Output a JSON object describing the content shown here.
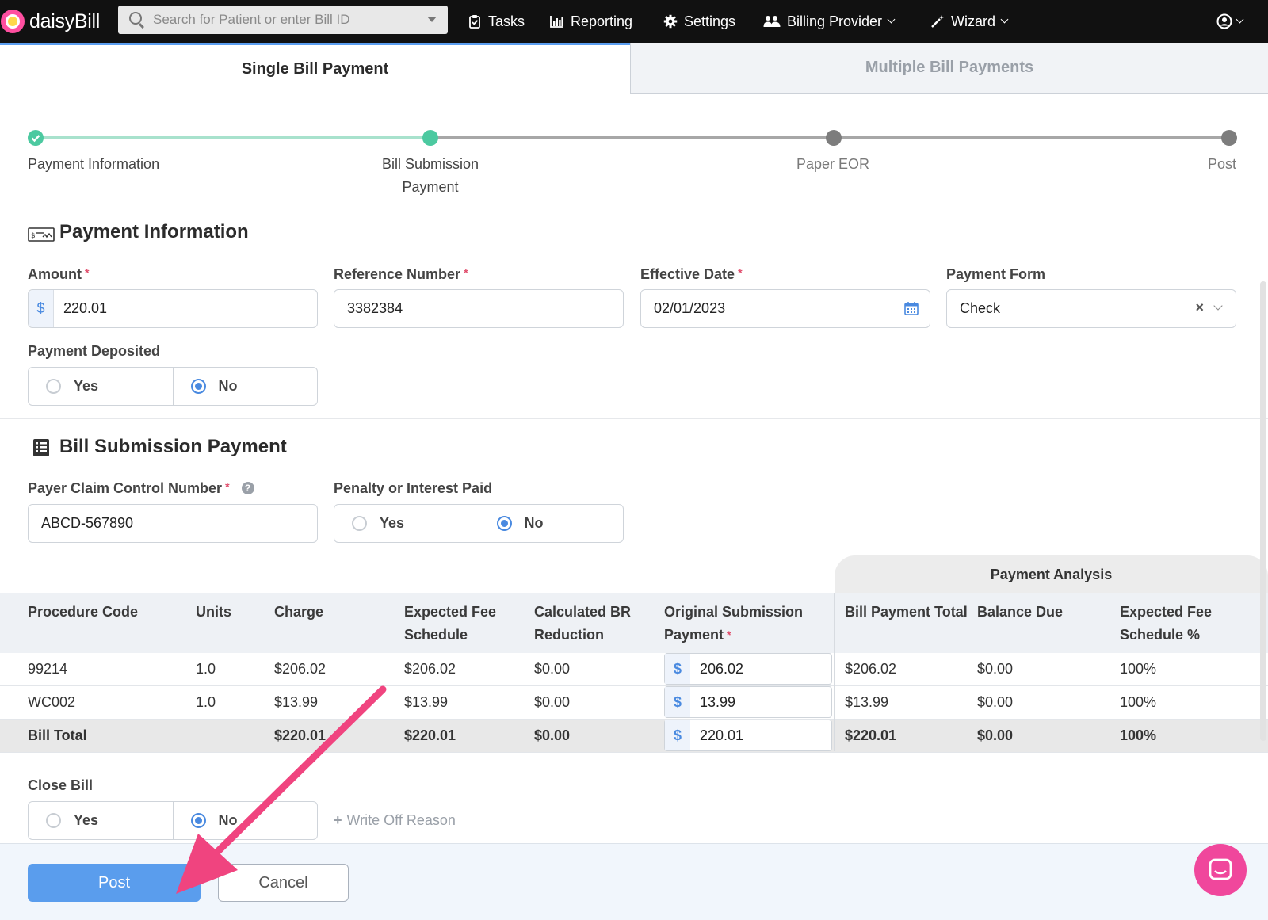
{
  "nav": {
    "logo_text": "daisyBill",
    "search_placeholder": "Search for Patient or enter Bill ID",
    "items": [
      {
        "label": "Tasks",
        "icon": "clipboard-check-icon"
      },
      {
        "label": "Reporting",
        "icon": "bar-chart-icon"
      },
      {
        "label": "Settings",
        "icon": "gear-icon"
      },
      {
        "label": "Billing Provider",
        "icon": "users-icon"
      },
      {
        "label": "Wizard",
        "icon": "magic-wand-icon"
      }
    ]
  },
  "tabs": {
    "single": "Single Bill Payment",
    "multiple": "Multiple Bill Payments"
  },
  "stepper": {
    "steps": [
      "Payment Information",
      "Bill Submission\nPayment",
      "Paper EOR",
      "Post"
    ],
    "step2_line1": "Bill Submission",
    "step2_line2": "Payment",
    "current_step": 2
  },
  "payment_info": {
    "title": "Payment Information",
    "amount_label": "Amount",
    "amount_prefix": "$",
    "amount_value": "220.01",
    "reference_label": "Reference Number",
    "reference_value": "3382384",
    "effective_date_label": "Effective Date",
    "effective_date_value": "02/01/2023",
    "payment_form_label": "Payment Form",
    "payment_form_value": "Check",
    "deposited_label": "Payment Deposited",
    "yes": "Yes",
    "no": "No"
  },
  "bill_submission": {
    "title": "Bill Submission Payment",
    "pccn_label": "Payer Claim Control Number",
    "pccn_value": "ABCD-567890",
    "penalty_label": "Penalty or Interest Paid",
    "yes": "Yes",
    "no": "No"
  },
  "table": {
    "payment_analysis": "Payment Analysis",
    "headers": {
      "procedure": "Procedure Code",
      "units": "Units",
      "charge": "Charge",
      "efs_1": "Expected Fee",
      "efs_2": "Schedule",
      "br_1": "Calculated BR",
      "br_2": "Reduction",
      "osp_1": "Original Submission",
      "osp_2": "Payment",
      "bpt": "Bill Payment Total",
      "balance": "Balance Due",
      "efsp_1": "Expected Fee",
      "efsp_2": "Schedule %"
    },
    "rows": [
      {
        "code": "99214",
        "units": "1.0",
        "charge": "$206.02",
        "efs": "$206.02",
        "br": "$0.00",
        "prefix": "$",
        "osp": "206.02",
        "bpt": "$206.02",
        "balance": "$0.00",
        "pct": "100%"
      },
      {
        "code": "WC002",
        "units": "1.0",
        "charge": "$13.99",
        "efs": "$13.99",
        "br": "$0.00",
        "prefix": "$",
        "osp": "13.99",
        "bpt": "$13.99",
        "balance": "$0.00",
        "pct": "100%"
      }
    ],
    "total": {
      "label": "Bill Total",
      "charge": "$220.01",
      "efs": "$220.01",
      "br": "$0.00",
      "prefix": "$",
      "osp": "220.01",
      "bpt": "$220.01",
      "balance": "$0.00",
      "pct": "100%"
    }
  },
  "close_bill": {
    "label": "Close Bill",
    "yes": "Yes",
    "no": "No",
    "write_off": "Write Off Reason"
  },
  "footer": {
    "post": "Post",
    "cancel": "Cancel"
  },
  "colors": {
    "accent": "#5a9ded",
    "step_done": "#4cc9a0",
    "arrow": "#f0447f",
    "chat": "#f0479c"
  }
}
